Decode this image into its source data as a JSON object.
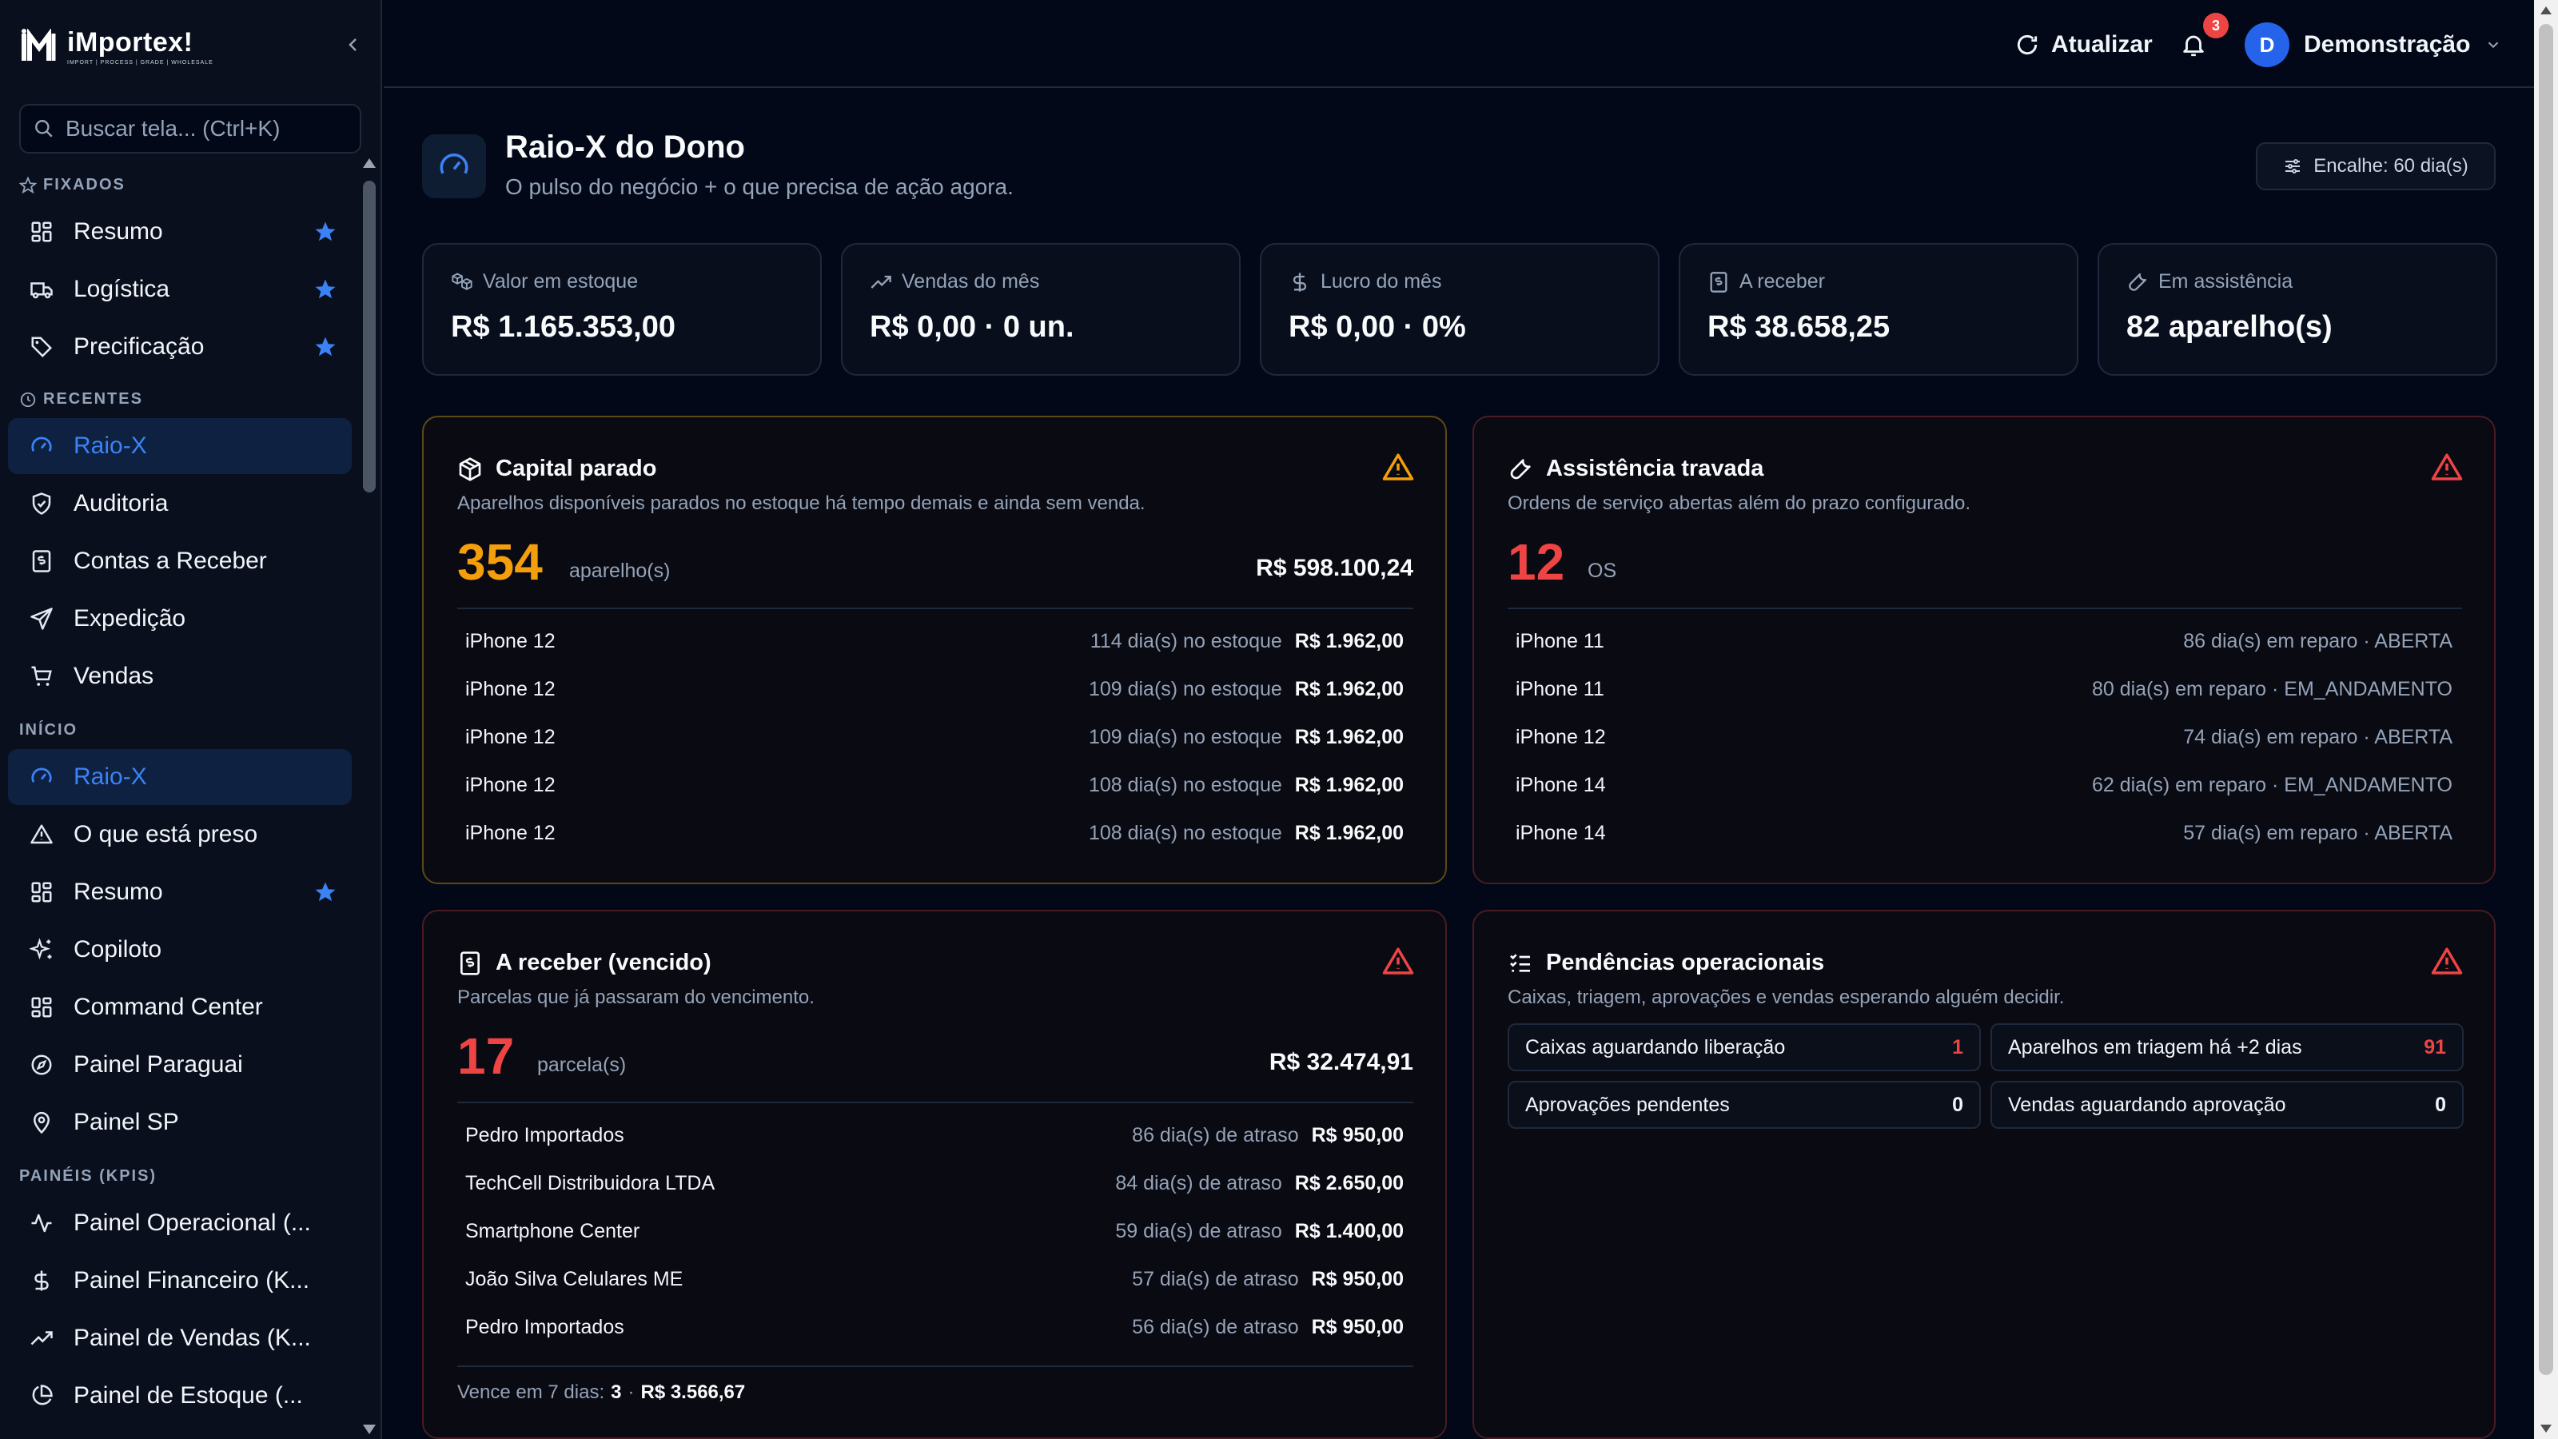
{
  "app": {
    "brand_title": "iMportex!",
    "brand_sub": "IMPORT | PROCESS | GRADE | WHOLESALE"
  },
  "search": {
    "placeholder": "Buscar tela... (Ctrl+K)"
  },
  "sidebar": {
    "sections": {
      "fixados": "FIXADOS",
      "recentes": "RECENTES",
      "inicio": "INÍCIO",
      "paineis": "PAINÉIS (KPIS)"
    },
    "fixados": [
      {
        "label": "Resumo",
        "icon": "dashboard-icon",
        "starred": true
      },
      {
        "label": "Logística",
        "icon": "truck-icon",
        "starred": true
      },
      {
        "label": "Precificação",
        "icon": "tag-icon",
        "starred": true
      }
    ],
    "recentes": [
      {
        "label": "Raio-X",
        "icon": "gauge-icon",
        "active": true
      },
      {
        "label": "Auditoria",
        "icon": "shield-check-icon"
      },
      {
        "label": "Contas a Receber",
        "icon": "receipt-icon"
      },
      {
        "label": "Expedição",
        "icon": "send-icon"
      },
      {
        "label": "Vendas",
        "icon": "cart-icon"
      }
    ],
    "inicio": [
      {
        "label": "Raio-X",
        "icon": "gauge-icon",
        "active": true
      },
      {
        "label": "O que está preso",
        "icon": "warning-icon"
      },
      {
        "label": "Resumo",
        "icon": "dashboard-icon",
        "starred": true
      },
      {
        "label": "Copiloto",
        "icon": "sparkles-icon"
      },
      {
        "label": "Command Center",
        "icon": "dashboard-icon"
      },
      {
        "label": "Painel Paraguai",
        "icon": "compass-icon"
      },
      {
        "label": "Painel SP",
        "icon": "map-pin-icon"
      }
    ],
    "paineis": [
      {
        "label": "Painel Operacional (...",
        "icon": "activity-icon"
      },
      {
        "label": "Painel Financeiro (K...",
        "icon": "dollar-icon"
      },
      {
        "label": "Painel de Vendas (K...",
        "icon": "trending-up-icon"
      },
      {
        "label": "Painel de Estoque (...",
        "icon": "pie-chart-icon"
      }
    ]
  },
  "topbar": {
    "refresh_label": "Atualizar",
    "notifications_count": "3",
    "user_initial": "D",
    "user_name": "Demonstração"
  },
  "header": {
    "title": "Raio-X do Dono",
    "subtitle": "O pulso do negócio + o que precisa de ação agora.",
    "encalhe_label": "Encalhe: 60 dia(s)"
  },
  "kpis": [
    {
      "label": "Valor em estoque",
      "value": "R$ 1.165.353,00",
      "icon": "boxes-icon"
    },
    {
      "label": "Vendas do mês",
      "value": "R$ 0,00 · 0 un.",
      "icon": "trending-up-icon"
    },
    {
      "label": "Lucro do mês",
      "value": "R$ 0,00 · 0%",
      "icon": "dollar-icon"
    },
    {
      "label": "A receber",
      "value": "R$ 38.658,25",
      "icon": "receipt-icon"
    },
    {
      "label": "Em assistência",
      "value": "82 aparelho(s)",
      "icon": "wrench-icon"
    }
  ],
  "cards": {
    "capital": {
      "title": "Capital parado",
      "desc": "Aparelhos disponíveis parados no estoque há tempo demais e ainda sem venda.",
      "count": "354",
      "unit": "aparelho(s)",
      "total": "R$ 598.100,24",
      "accent": "#f59e0b",
      "rows": [
        {
          "name": "iPhone 12",
          "meta": "114 dia(s) no estoque",
          "value": "R$ 1.962,00"
        },
        {
          "name": "iPhone 12",
          "meta": "109 dia(s) no estoque",
          "value": "R$ 1.962,00"
        },
        {
          "name": "iPhone 12",
          "meta": "109 dia(s) no estoque",
          "value": "R$ 1.962,00"
        },
        {
          "name": "iPhone 12",
          "meta": "108 dia(s) no estoque",
          "value": "R$ 1.962,00"
        },
        {
          "name": "iPhone 12",
          "meta": "108 dia(s) no estoque",
          "value": "R$ 1.962,00"
        }
      ]
    },
    "assistencia": {
      "title": "Assistência travada",
      "desc": "Ordens de serviço abertas além do prazo configurado.",
      "count": "12",
      "unit": "OS",
      "accent": "#ef4444",
      "rows": [
        {
          "name": "iPhone 11",
          "meta": "86 dia(s) em reparo · ABERTA"
        },
        {
          "name": "iPhone 11",
          "meta": "80 dia(s) em reparo · EM_ANDAMENTO"
        },
        {
          "name": "iPhone 12",
          "meta": "74 dia(s) em reparo · ABERTA"
        },
        {
          "name": "iPhone 14",
          "meta": "62 dia(s) em reparo · EM_ANDAMENTO"
        },
        {
          "name": "iPhone 14",
          "meta": "57 dia(s) em reparo · ABERTA"
        }
      ]
    },
    "receber": {
      "title": "A receber (vencido)",
      "desc": "Parcelas que já passaram do vencimento.",
      "count": "17",
      "unit": "parcela(s)",
      "total": "R$ 32.474,91",
      "accent": "#ef4444",
      "rows": [
        {
          "name": "Pedro Importados",
          "meta": "86 dia(s) de atraso",
          "value": "R$ 950,00"
        },
        {
          "name": "TechCell Distribuidora LTDA",
          "meta": "84 dia(s) de atraso",
          "value": "R$ 2.650,00"
        },
        {
          "name": "Smartphone Center",
          "meta": "59 dia(s) de atraso",
          "value": "R$ 1.400,00"
        },
        {
          "name": "João Silva Celulares ME",
          "meta": "57 dia(s) de atraso",
          "value": "R$ 950,00"
        },
        {
          "name": "Pedro Importados",
          "meta": "56 dia(s) de atraso",
          "value": "R$ 950,00"
        }
      ],
      "footer_label": "Vence em 7 dias:",
      "footer_count": "3",
      "footer_sep": "·",
      "footer_value": "R$ 3.566,67"
    },
    "pendencias": {
      "title": "Pendências operacionais",
      "desc": "Caixas, triagem, aprovações e vendas esperando alguém decidir.",
      "items": [
        {
          "label": "Caixas aguardando liberação",
          "value": "1",
          "alert": true
        },
        {
          "label": "Aparelhos em triagem há +2 dias",
          "value": "91",
          "alert": true
        },
        {
          "label": "Aprovações pendentes",
          "value": "0",
          "alert": false
        },
        {
          "label": "Vendas aguardando aprovação",
          "value": "0",
          "alert": false
        }
      ]
    }
  }
}
